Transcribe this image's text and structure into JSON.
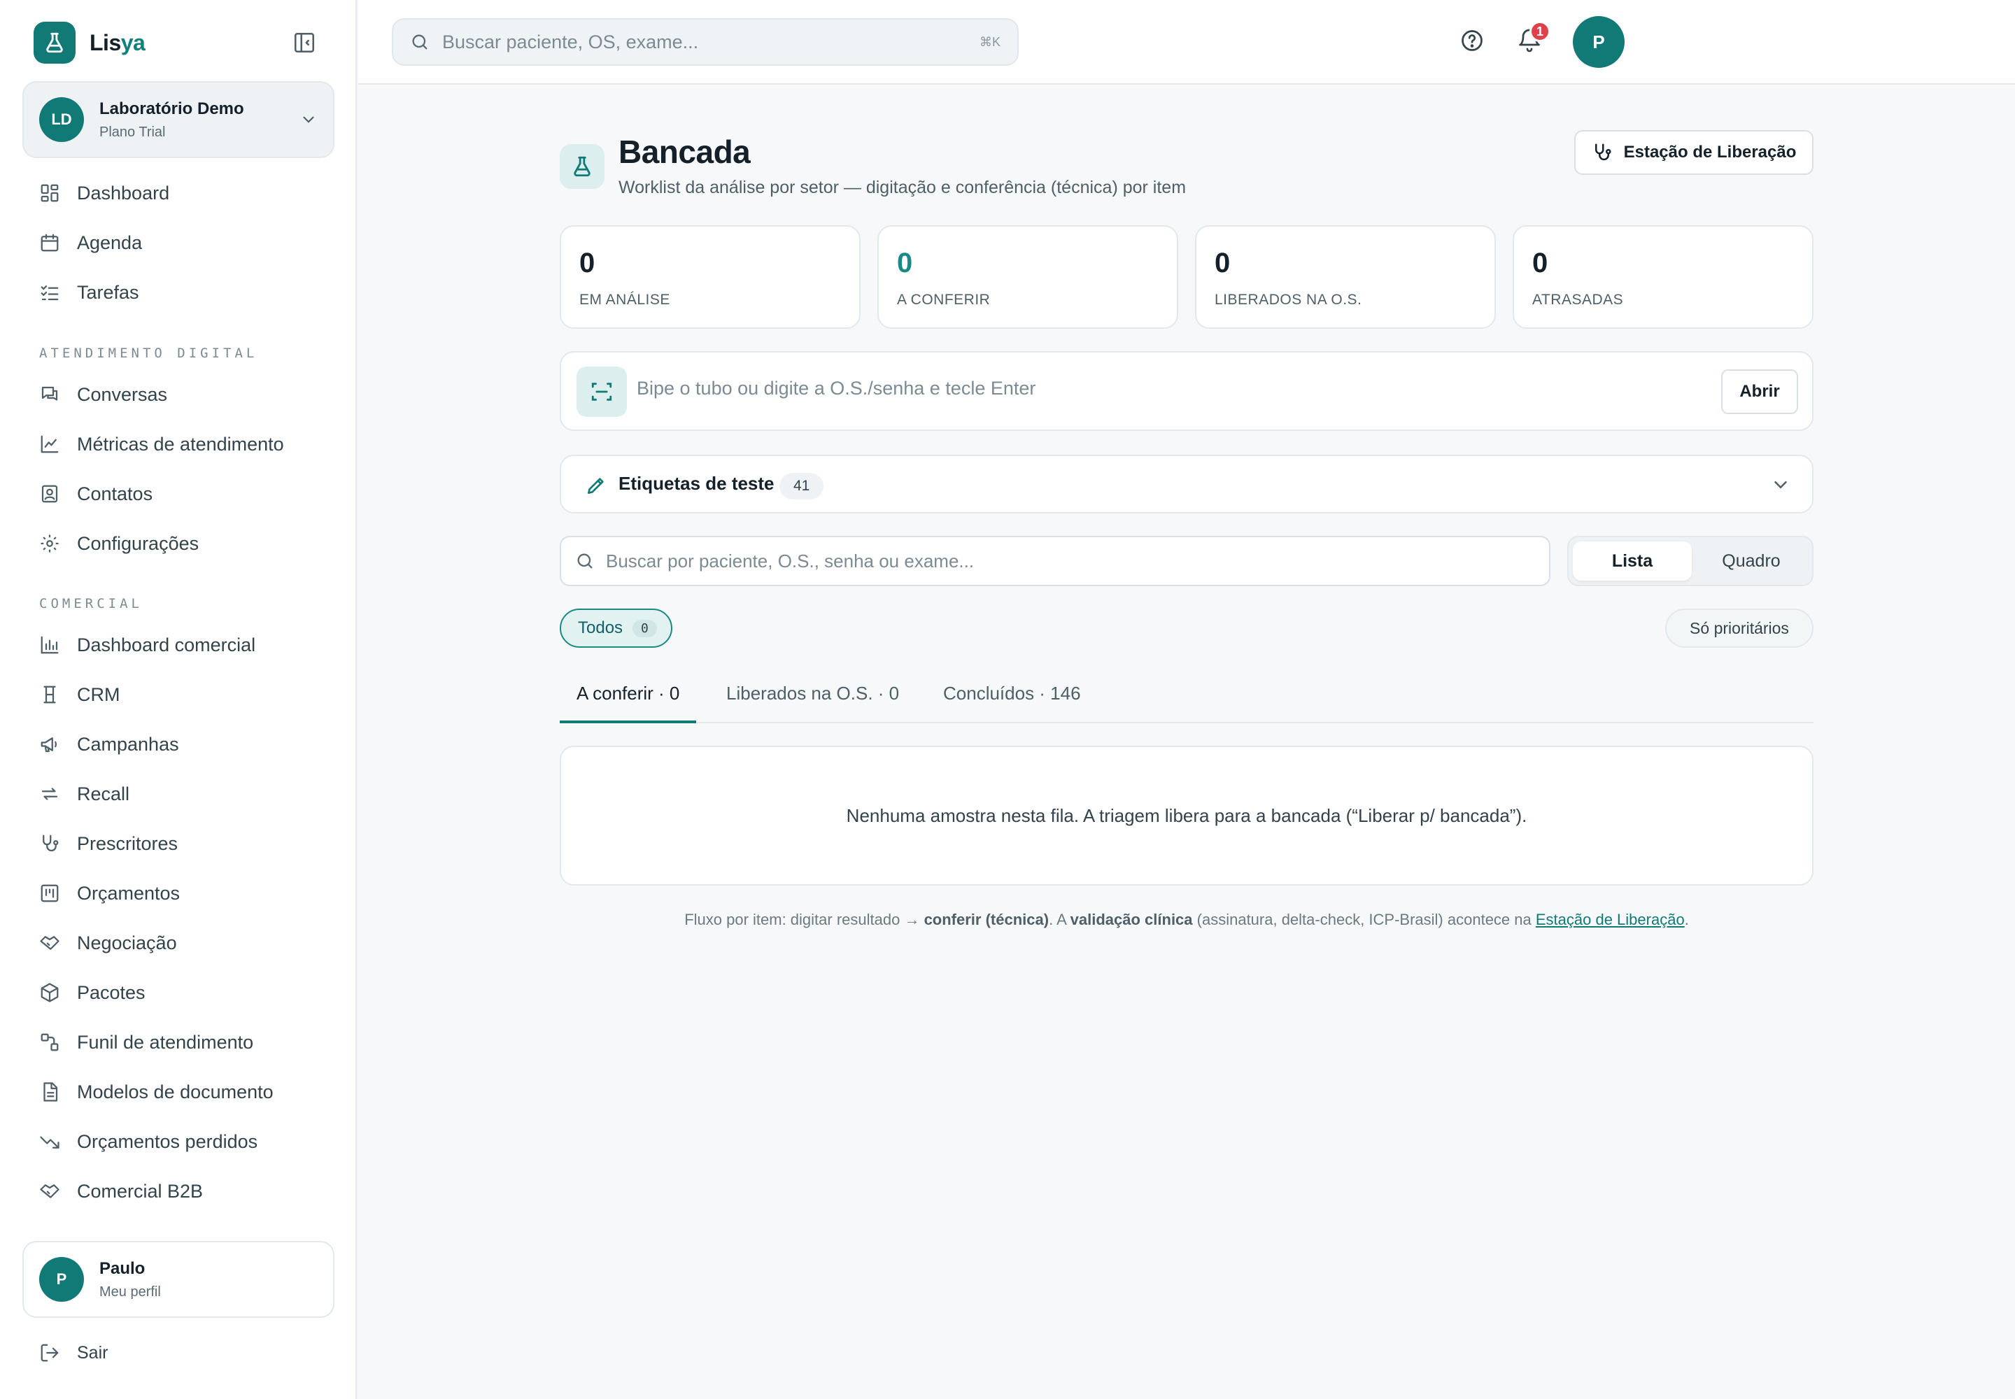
{
  "brand": {
    "name_main": "Lis",
    "name_accent": "ya"
  },
  "org": {
    "initials": "LD",
    "name": "Laboratório Demo",
    "plan": "Plano Trial"
  },
  "nav": {
    "top": [
      {
        "label": "Dashboard",
        "icon": "dashboard-icon"
      },
      {
        "label": "Agenda",
        "icon": "calendar-icon"
      },
      {
        "label": "Tarefas",
        "icon": "checklist-icon"
      }
    ],
    "section_digital": "ATENDIMENTO DIGITAL",
    "digital": [
      {
        "label": "Conversas",
        "icon": "chat-icon"
      },
      {
        "label": "Métricas de atendimento",
        "icon": "line-chart-icon"
      },
      {
        "label": "Contatos",
        "icon": "contact-icon"
      },
      {
        "label": "Configurações",
        "icon": "gear-icon"
      }
    ],
    "section_comercial": "COMERCIAL",
    "comercial": [
      {
        "label": "Dashboard comercial",
        "icon": "bar-chart-icon"
      },
      {
        "label": "CRM",
        "icon": "crm-icon"
      },
      {
        "label": "Campanhas",
        "icon": "megaphone-icon"
      },
      {
        "label": "Recall",
        "icon": "recall-icon"
      },
      {
        "label": "Prescritores",
        "icon": "stethoscope-icon"
      },
      {
        "label": "Orçamentos",
        "icon": "budget-icon"
      },
      {
        "label": "Negociação",
        "icon": "handshake-icon"
      },
      {
        "label": "Pacotes",
        "icon": "package-icon"
      },
      {
        "label": "Funil de atendimento",
        "icon": "funnel-icon"
      },
      {
        "label": "Modelos de documento",
        "icon": "document-icon"
      },
      {
        "label": "Orçamentos perdidos",
        "icon": "trend-down-icon"
      },
      {
        "label": "Comercial B2B",
        "icon": "handshake-icon"
      }
    ]
  },
  "profile": {
    "initial": "P",
    "name": "Paulo",
    "sub": "Meu perfil"
  },
  "logout_label": "Sair",
  "topbar": {
    "search_placeholder": "Buscar paciente, OS, exame...",
    "shortcut": "⌘K",
    "notification_count": "1",
    "user_initial": "P"
  },
  "page": {
    "title": "Bancada",
    "subtitle": "Worklist da análise por setor — digitação e conferência (técnica) por item",
    "release_button": "Estação de Liberação"
  },
  "stats": [
    {
      "value": "0",
      "label": "EM ANÁLISE"
    },
    {
      "value": "0",
      "label": "A CONFERIR"
    },
    {
      "value": "0",
      "label": "LIBERADOS NA O.S."
    },
    {
      "value": "0",
      "label": "ATRASADAS"
    }
  ],
  "scan": {
    "placeholder": "Bipe o tubo ou digite a O.S./senha e tecle Enter",
    "button": "Abrir"
  },
  "labels_bar": {
    "title": "Etiquetas de teste",
    "count": "41"
  },
  "list_search": {
    "placeholder": "Buscar por paciente, O.S., senha ou exame..."
  },
  "view_toggle": {
    "list": "Lista",
    "board": "Quadro",
    "selected": "Lista"
  },
  "filters": {
    "all_label": "Todos",
    "all_count": "0",
    "priority_label": "Só prioritários"
  },
  "tabs": [
    {
      "label": "A conferir · 0",
      "active": true
    },
    {
      "label": "Liberados na O.S. · 0",
      "active": false
    },
    {
      "label": "Concluídos · 146",
      "active": false
    }
  ],
  "empty_message": "Nenhuma amostra nesta fila. A triagem libera para a bancada (“Liberar p/ bancada”).",
  "footnote": {
    "part1": "Fluxo por item: digitar resultado → ",
    "bold1": "conferir (técnica)",
    "part2": ". A ",
    "bold2": "validação clínica",
    "part3": " (assinatura, delta-check, ICP-Brasil) acontece na ",
    "link": "Estação de Liberação",
    "part4": "."
  },
  "colors": {
    "accent": "#127a76",
    "badge": "#e0404a",
    "background": "#f6f8f9"
  }
}
